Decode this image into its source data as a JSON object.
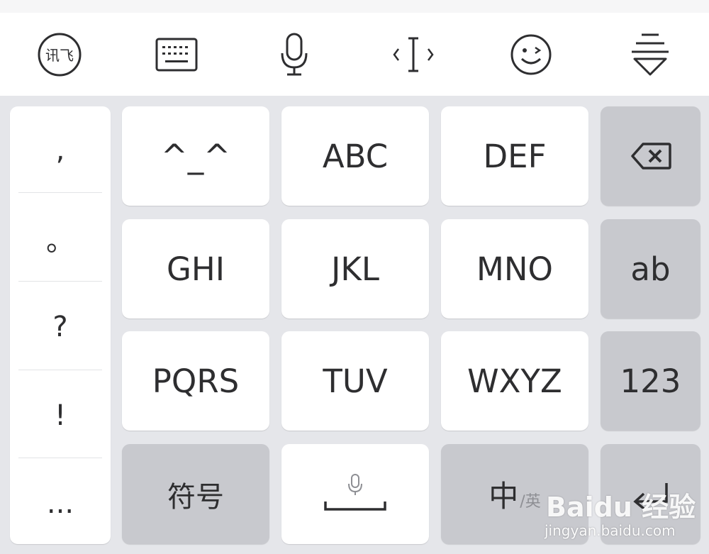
{
  "toolbar": {
    "items": [
      {
        "icon": "ifly-logo-icon",
        "text": "讯飞"
      },
      {
        "icon": "keyboard-icon"
      },
      {
        "icon": "microphone-icon"
      },
      {
        "icon": "cursor-move-icon"
      },
      {
        "icon": "emoji-icon"
      },
      {
        "icon": "hide-keyboard-icon"
      }
    ]
  },
  "punctuation": [
    ",",
    "。",
    "?",
    "!",
    "..."
  ],
  "keys": {
    "row1": [
      "^_^",
      "ABC",
      "DEF"
    ],
    "row2": [
      "GHI",
      "JKL",
      "MNO"
    ],
    "row3": [
      "PQRS",
      "TUV",
      "WXYZ"
    ]
  },
  "function_keys": {
    "backspace_icon": "backspace-icon",
    "letters": "ab",
    "numbers": "123",
    "symbols": "符号",
    "space_icon": "space-mic-icon",
    "lang_main": "中",
    "lang_sub": "/英",
    "enter_icon": "enter-icon"
  },
  "watermark": {
    "logo": "Baidu 经验",
    "url": "jingyan.baidu.com"
  },
  "colors": {
    "keyboard_bg": "#e5e6ea",
    "key_bg": "#ffffff",
    "function_key_bg": "#c8c9ce",
    "text": "#2e2e30"
  }
}
